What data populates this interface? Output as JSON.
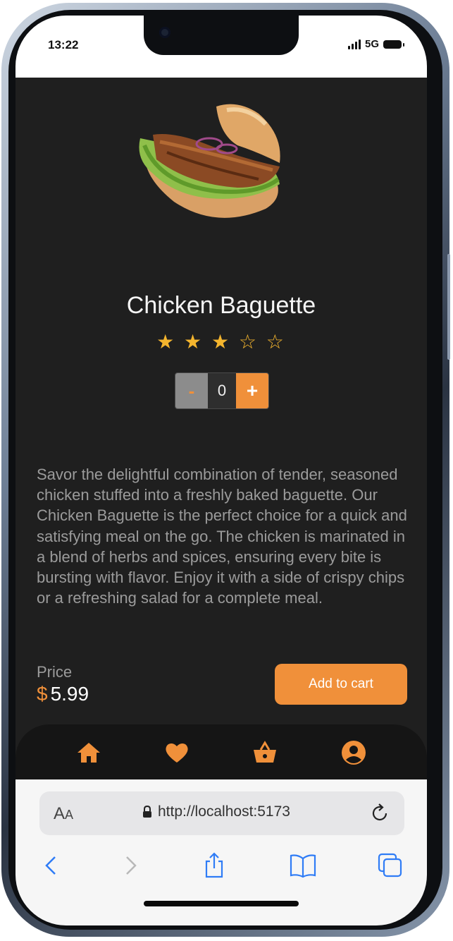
{
  "status_bar": {
    "time": "13:22",
    "network": "5G"
  },
  "product": {
    "name": "Chicken Baguette",
    "rating": 3,
    "rating_max": 5,
    "quantity": "0",
    "minus_label": "-",
    "plus_label": "+",
    "description": "Savor the delightful combination of tender, seasoned chicken stuffed into a freshly baked baguette. Our Chicken Baguette is the perfect choice for a quick and satisfying meal on the go. The chicken is marinated in a blend of herbs and spices, ensuring every bite is bursting with flavor. Enjoy it with a side of crispy chips or a refreshing salad for a complete meal.",
    "price_label": "Price",
    "currency": "$",
    "price": "5.99",
    "add_to_cart_label": "Add to cart"
  },
  "tab_bar": {
    "items": [
      {
        "icon": "home-icon"
      },
      {
        "icon": "heart-icon"
      },
      {
        "icon": "basket-icon"
      },
      {
        "icon": "user-icon"
      }
    ]
  },
  "browser": {
    "text_size_label_big": "A",
    "text_size_label_small": "A",
    "url": "http://localhost:5173"
  },
  "colors": {
    "accent": "#f0903a",
    "background": "#1f1f1f",
    "star": "#f4b52e"
  }
}
